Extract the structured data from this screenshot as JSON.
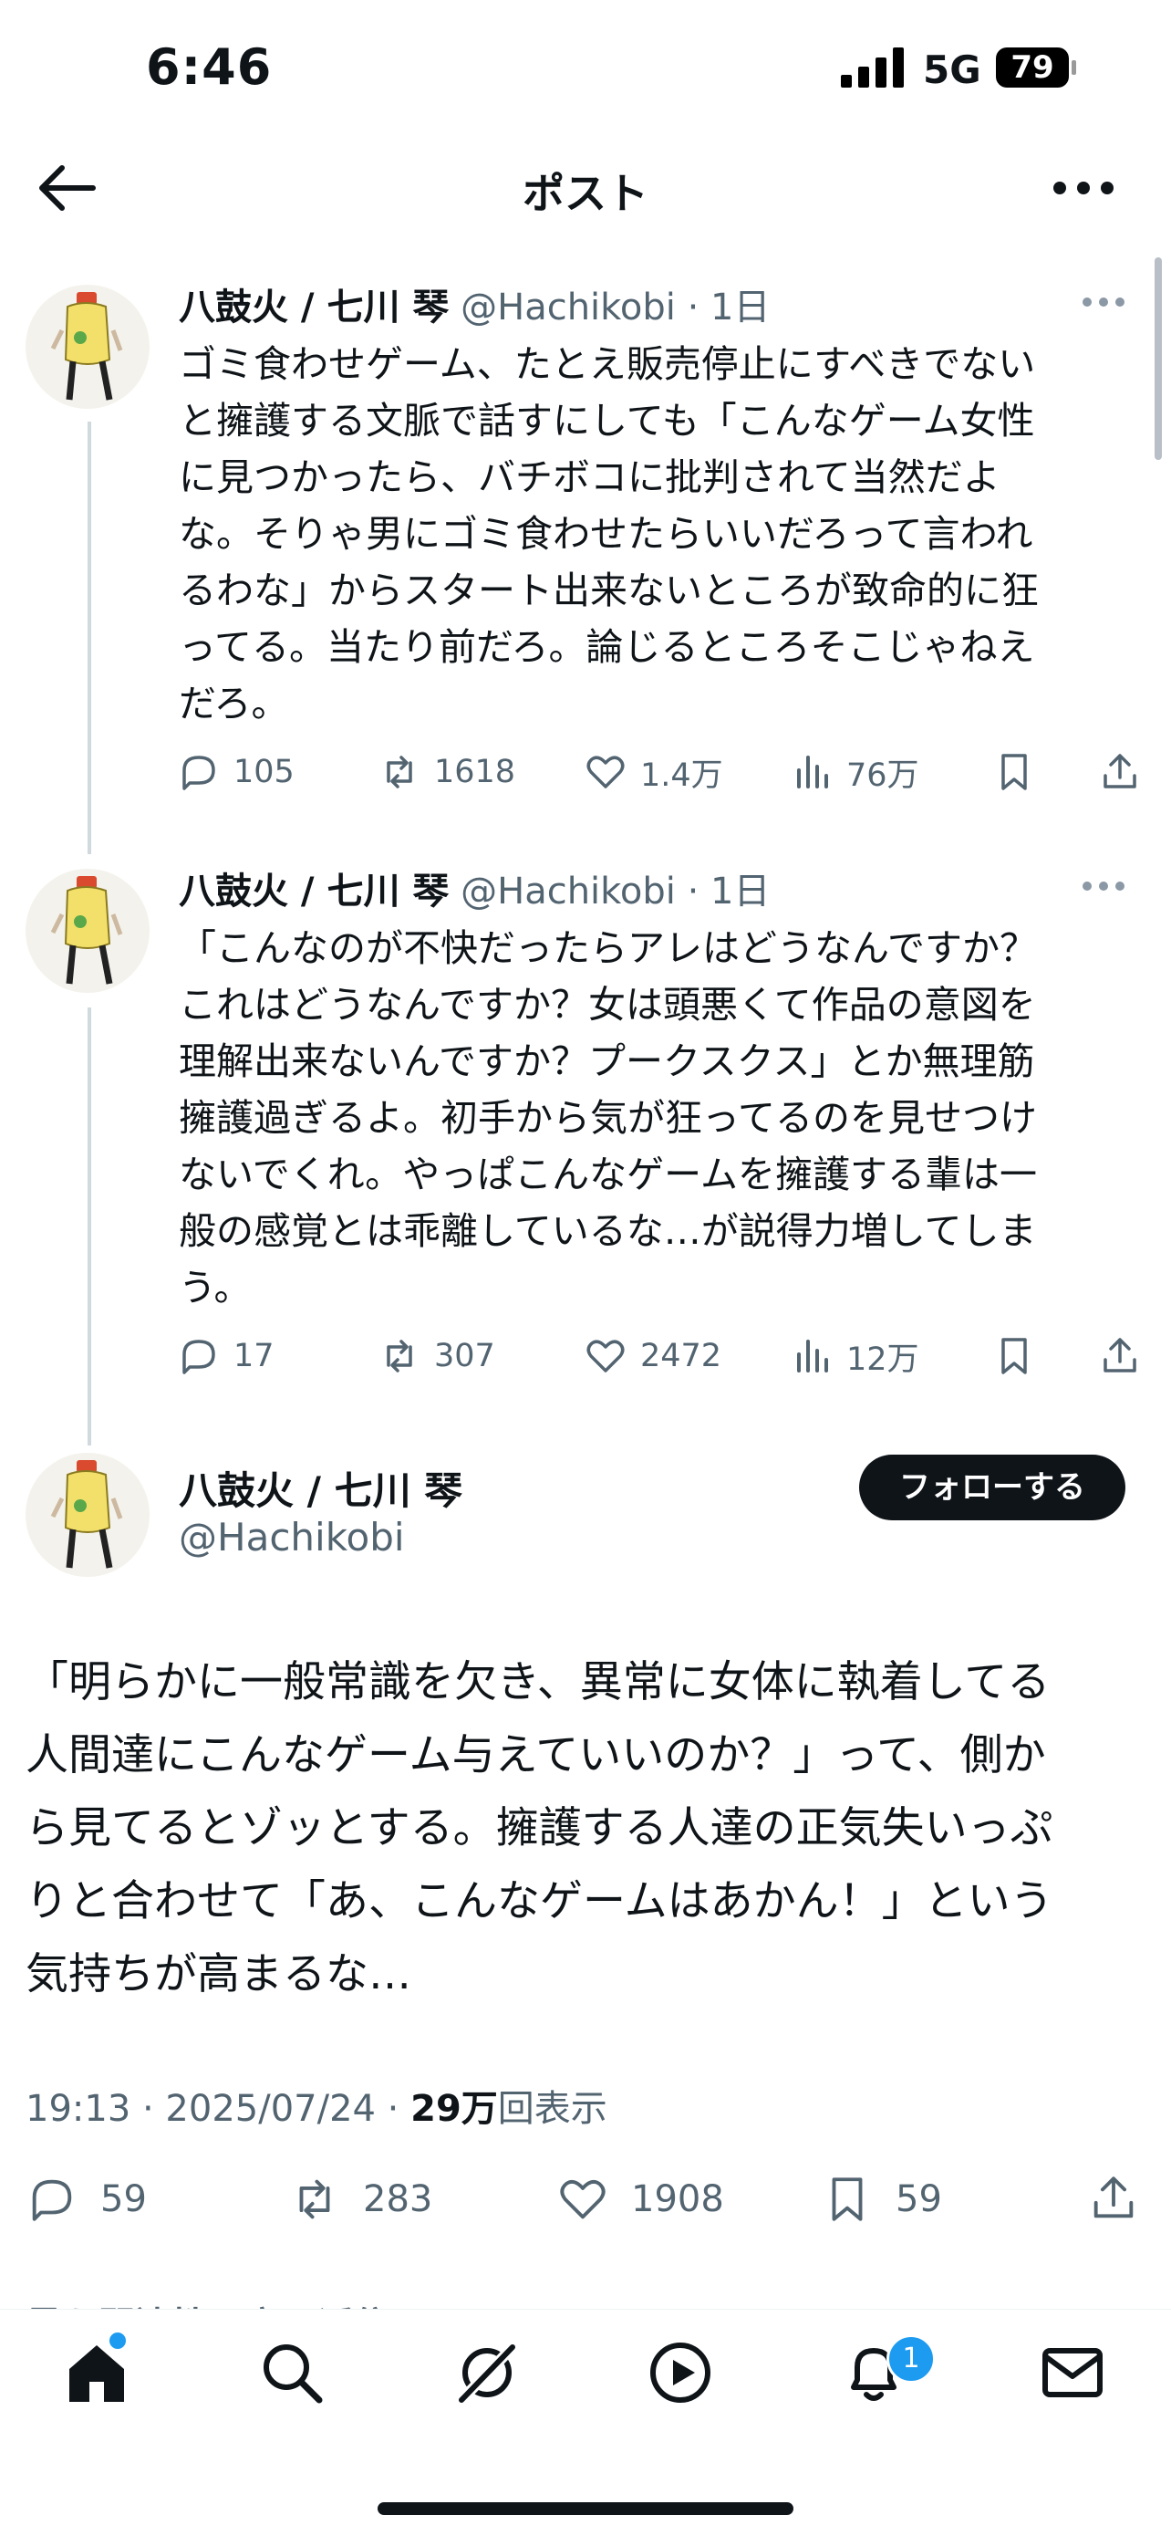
{
  "status_bar": {
    "time": "6:46",
    "network": "5G",
    "battery": "79"
  },
  "header": {
    "title": "ポスト",
    "back_icon": "arrow-left-icon",
    "more_icon": "more-horizontal-icon"
  },
  "thread": [
    {
      "name": "八鼓火 / 七川 琴",
      "handle": "@Hachikobi",
      "time": "1日",
      "text": "ゴミ食わせゲーム、たとえ販売停止にすべきでない\nと擁護する文脈で話すにしても「こんなゲーム女性\nに見つかったら、バチボコに批判されて当然だよ\nな。そりゃ男にゴミ食わせたらいいだろって言われ\nるわな」からスタート出来ないところが致命的に狂\nってる。当たり前だろ。論じるところそこじゃねえ\nだろ。",
      "replies": "105",
      "reposts": "1618",
      "likes": "1.4万",
      "views": "76万"
    },
    {
      "name": "八鼓火 / 七川 琴",
      "handle": "@Hachikobi",
      "time": "1日",
      "text": "「こんなのが不快だったらアレはどうなんですか？\nこれはどうなんですか？女は頭悪くて作品の意図を\n理解出来ないんですか？プークスクス」とか無理筋\n擁護過ぎるよ。初手から気が狂ってるのを見せつけ\nないでくれ。やっぱこんなゲームを擁護する輩は一\n般の感覚とは乖離しているな…が説得力増してしま\nう。",
      "replies": "17",
      "reposts": "307",
      "likes": "2472",
      "views": "12万"
    }
  ],
  "main": {
    "name": "八鼓火 / 七川 琴",
    "handle": "@Hachikobi",
    "follow_label": "フォローする",
    "text": "「明らかに一般常識を欠き、異常に女体に執着してる\n人間達にこんなゲーム与えていいのか？」って、側か\nら見てるとゾッとする。擁護する人達の正気失いっぷ\nりと合わせて「あ、こんなゲームはあかん！」という\n気持ちが高まるな…",
    "timestamp": "19:13 · 2025/07/24 · ",
    "views_count": "29万",
    "views_label": "回表示",
    "replies": "59",
    "reposts": "283",
    "likes": "1908",
    "bookmarks": "59"
  },
  "next_section_peek": "最も関連性の高い返信",
  "tabbar": {
    "tabs": [
      "home-icon",
      "search-icon",
      "grok-icon",
      "video-icon",
      "notifications-icon",
      "messages-icon"
    ],
    "notification_badge": "1"
  },
  "colors": {
    "text": "#0f1419",
    "secondary": "#536471",
    "accent": "#1d9bf0",
    "line": "#cfd9de"
  }
}
